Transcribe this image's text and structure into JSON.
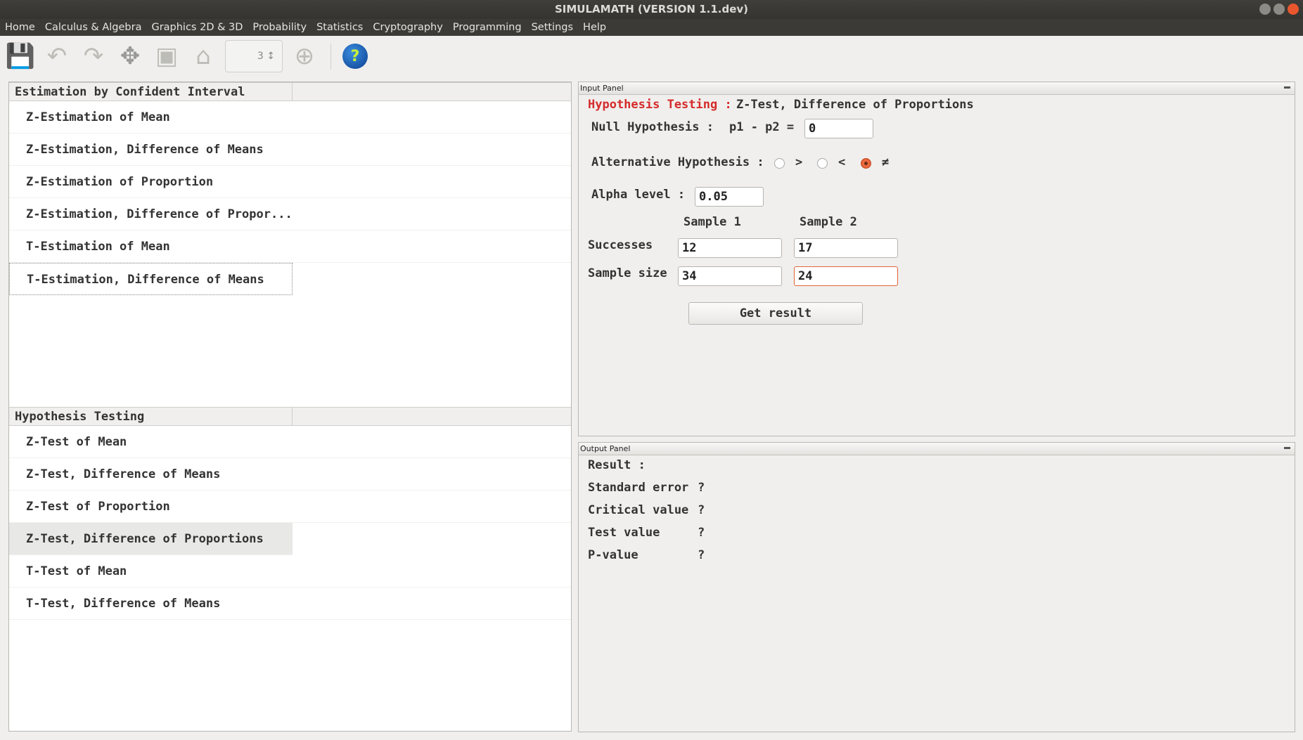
{
  "window": {
    "title": "SIMULAMATH   (VERSION 1.1.dev)"
  },
  "menu": [
    "Home",
    "Calculus & Algebra",
    "Graphics 2D & 3D",
    "Probability",
    "Statistics",
    "Cryptography",
    "Programming",
    "Settings",
    "Help"
  ],
  "toolbar": {
    "icons": [
      "save-icon",
      "undo-icon",
      "redo-icon",
      "expand-icon",
      "fit-icon",
      "home-icon",
      "axis-spinner",
      "add-icon",
      "help-icon"
    ],
    "spinner_value": "3",
    "help_glyph": "?"
  },
  "estimation": {
    "header": "Estimation by Confident Interval",
    "items": [
      "Z-Estimation of Mean",
      "Z-Estimation, Difference of Means",
      "Z-Estimation of Proportion",
      "Z-Estimation, Difference of Propor...",
      "T-Estimation of Mean",
      "T-Estimation, Difference of Means"
    ]
  },
  "hypothesis": {
    "header": "Hypothesis Testing",
    "items": [
      "Z-Test of Mean",
      "Z-Test, Difference of Means",
      "Z-Test of Proportion",
      "Z-Test, Difference of Proportions",
      "T-Test of Mean",
      "T-Test, Difference of Means"
    ],
    "selected": "Z-Test, Difference of Proportions"
  },
  "input_panel": {
    "title": "Input Panel",
    "heading_prefix": "Hypothesis Testing :",
    "heading": "Z-Test, Difference of Proportions",
    "heading_color": "#d52b2b",
    "null_label": "Null Hypothesis :",
    "null_expr": "p1 - p2 =",
    "null_value": "0",
    "alt_label": "Alternative Hypothesis :",
    "alt_options": [
      ">",
      "<",
      "≠"
    ],
    "alt_selected": "≠",
    "alpha_label": "Alpha level :",
    "alpha_value": "0.05",
    "sample1": "Sample 1",
    "sample2": "Sample 2",
    "successes_label": "Successes",
    "successes1": "12",
    "successes2": "17",
    "size_label": "Sample size",
    "size1": "34",
    "size2": "24",
    "button": "Get result"
  },
  "output_panel": {
    "title": "Output Panel",
    "result_label": "Result :",
    "rows": [
      {
        "label": "Standard error",
        "value": "?"
      },
      {
        "label": "Critical value",
        "value": "?"
      },
      {
        "label": "Test value",
        "value": "?"
      },
      {
        "label": "P-value",
        "value": "?"
      }
    ]
  }
}
